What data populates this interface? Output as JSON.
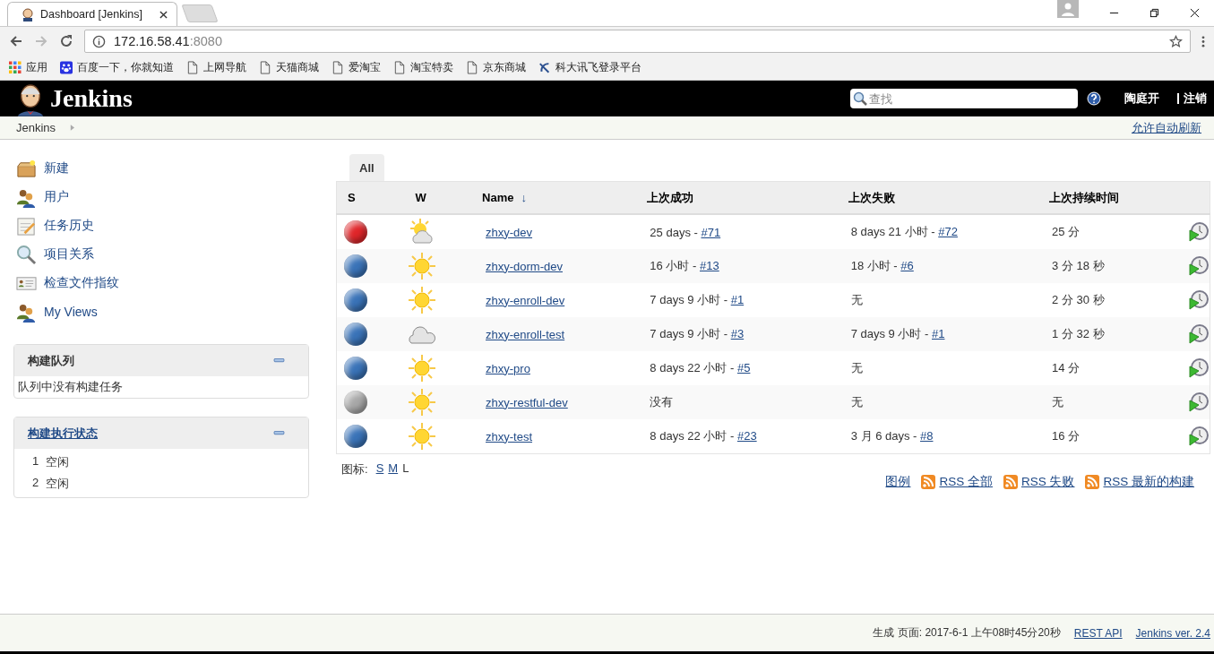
{
  "browser": {
    "tabs": [
      {
        "title": "Dashboard [Jenkins]",
        "selected": true
      },
      {
        "selected": false
      }
    ],
    "address": {
      "host": "172.16.58.41",
      "port": ":8080"
    },
    "bookmarks": [
      {
        "kind": "apps",
        "label": "应用"
      },
      {
        "kind": "paw",
        "label": "百度一下，你就知道"
      },
      {
        "kind": "page",
        "label": "上网导航"
      },
      {
        "kind": "page",
        "label": "天猫商城"
      },
      {
        "kind": "page",
        "label": "爱淘宝"
      },
      {
        "kind": "page",
        "label": "淘宝特卖"
      },
      {
        "kind": "page",
        "label": "京东商城"
      },
      {
        "kind": "xf",
        "label": "科大讯飞登录平台"
      }
    ]
  },
  "header": {
    "logo": "Jenkins",
    "search": {
      "placeholder": "查找"
    },
    "user": "陶庭开",
    "logout": "注销"
  },
  "breadcrumb": {
    "items": [
      "Jenkins"
    ],
    "auto_refresh": "允许自动刷新"
  },
  "sidebar": {
    "items": [
      {
        "kind": "new",
        "label": "新建"
      },
      {
        "kind": "people",
        "label": "用户"
      },
      {
        "kind": "notepad",
        "label": "任务历史"
      },
      {
        "kind": "search",
        "label": "项目关系"
      },
      {
        "kind": "card",
        "label": "检查文件指纹"
      },
      {
        "kind": "people",
        "label": "My Views"
      }
    ],
    "panels": [
      {
        "title": "构建队列",
        "title_link": false,
        "empty": "队列中没有构建任务"
      },
      {
        "title": "构建执行状态",
        "title_link": true,
        "executors": [
          {
            "number": "1",
            "state": "空闲"
          },
          {
            "number": "2",
            "state": "空闲"
          }
        ]
      }
    ]
  },
  "view_tabs": [
    {
      "label": "All",
      "selected": true
    }
  ],
  "table": {
    "columns": [
      "S",
      "W",
      "Name",
      "上次成功",
      "上次失败",
      "上次持续时间"
    ],
    "sort_indicator": "↓",
    "rows": [
      {
        "color": "#e0262a",
        "weather": {
          "kind": "partly_cloudy"
        },
        "name": "zhxy-dev",
        "last_success": {
          "text": "25 days -",
          "build": "#71"
        },
        "last_failure": {
          "text": "8 days 21 小时 -",
          "build": "#72"
        },
        "duration": "25 分"
      },
      {
        "color": "#3a73b8",
        "weather": {
          "kind": "sunny"
        },
        "name": "zhxy-dorm-dev",
        "last_success": {
          "text": "16 小时 -",
          "build": "#13"
        },
        "last_failure": {
          "text": "18 小时 -",
          "build": "#6"
        },
        "duration": "3 分 18 秒"
      },
      {
        "color": "#3a73b8",
        "weather": {
          "kind": "sunny"
        },
        "name": "zhxy-enroll-dev",
        "last_success": {
          "text": "7 days 9 小时 -",
          "build": "#1"
        },
        "last_failure": {
          "text": "无"
        },
        "duration": "2 分 30 秒"
      },
      {
        "color": "#3a73b8",
        "weather": {
          "kind": "cloudy"
        },
        "name": "zhxy-enroll-test",
        "last_success": {
          "text": "7 days 9 小时 -",
          "build": "#3"
        },
        "last_failure": {
          "text": "7 days 9 小时 -",
          "build": "#1"
        },
        "duration": "1 分 32 秒"
      },
      {
        "color": "#3a73b8",
        "weather": {
          "kind": "sunny"
        },
        "name": "zhxy-pro",
        "last_success": {
          "text": "8 days 22 小时 -",
          "build": "#5"
        },
        "last_failure": {
          "text": "无"
        },
        "duration": "14 分"
      },
      {
        "color": "#a8a8a8",
        "weather": {
          "kind": "sunny"
        },
        "name": "zhxy-restful-dev",
        "last_success": {
          "text": "没有"
        },
        "last_failure": {
          "text": "无"
        },
        "duration": "无"
      },
      {
        "color": "#3a73b8",
        "weather": {
          "kind": "sunny"
        },
        "name": "zhxy-test",
        "last_success": {
          "text": "8 days 22 小时 -",
          "build": "#23"
        },
        "last_failure": {
          "text": "3 月 6 days -",
          "build": "#8"
        },
        "duration": "16 分"
      }
    ]
  },
  "icon_size": {
    "label": "图标:",
    "options": [
      {
        "label": "S",
        "selected": false
      },
      {
        "label": "M",
        "selected": false
      },
      {
        "label": "L",
        "selected": true
      }
    ]
  },
  "feeds": {
    "legend": "图例",
    "links": [
      "RSS 全部",
      "RSS 失败",
      "RSS 最新的构建"
    ]
  },
  "footer": {
    "generated": "生成 页面: 2017-6-1 上午08时45分20秒",
    "rest_api": "REST API",
    "version": "Jenkins ver. 2.4"
  }
}
